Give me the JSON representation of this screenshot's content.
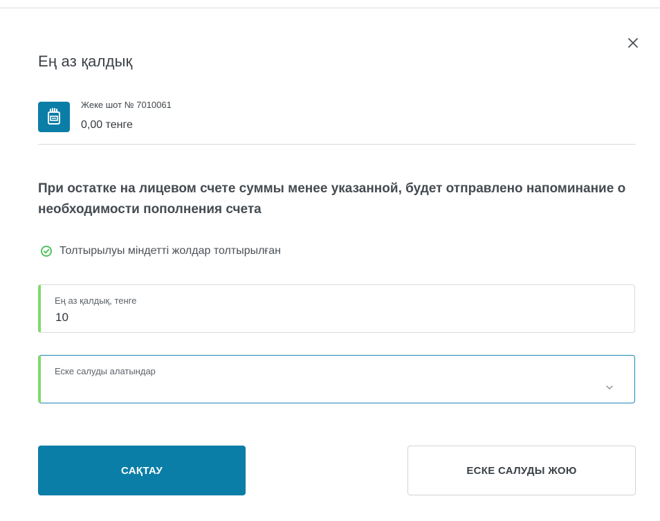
{
  "dialog": {
    "title": "Ең аз қалдық",
    "close_icon": "close-icon"
  },
  "account": {
    "icon": "wallet-icon",
    "label": "Жеке шот № 7010061",
    "balance": "0,00 тенге"
  },
  "description": "При остатке на лицевом счете суммы менее указанной, будет отправлено напоминание о необходимости пополнения счета",
  "status": {
    "icon": "check-circle-icon",
    "text": "Толтырылуы міндетті жолдар толтырылған"
  },
  "form": {
    "amount": {
      "label": "Ең аз қалдық, тенге",
      "value": "10"
    },
    "recipients": {
      "label": "Еске салуды алатындар",
      "value": "",
      "icon": "chevron-down-icon"
    }
  },
  "buttons": {
    "save": "САҚТАУ",
    "delete_reminder": "ЕСКЕ САЛУДЫ ЖОЮ"
  },
  "colors": {
    "primary": "#0b7ea7",
    "valid_accent": "#7fd96a",
    "focus_border": "#1b86b4"
  }
}
